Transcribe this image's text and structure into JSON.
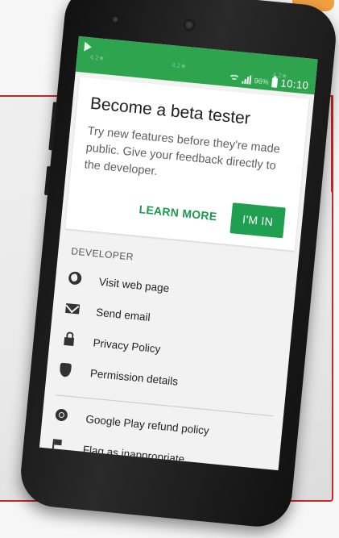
{
  "status_bar": {
    "time": "10:10",
    "battery_percent": "96%",
    "faint_left": "4.2★",
    "faint_mid": "4.2★",
    "faint_right": "4.2★"
  },
  "beta_card": {
    "title": "Become a beta tester",
    "body": "Try new features before they're made public. Give your feedback directly to the developer.",
    "learn_more": "LEARN MORE",
    "im_in": "I'M IN"
  },
  "developer": {
    "section_label": "DEVELOPER",
    "items": [
      {
        "label": "Visit web page",
        "icon": "globe-icon"
      },
      {
        "label": "Send email",
        "icon": "mail-icon"
      },
      {
        "label": "Privacy Policy",
        "icon": "lock-icon"
      },
      {
        "label": "Permission details",
        "icon": "shield-icon"
      }
    ]
  },
  "footer_items": [
    {
      "label": "Google Play refund policy",
      "icon": "refund-icon"
    },
    {
      "label": "Flag as inappropriate",
      "icon": "flag-icon"
    }
  ],
  "colors": {
    "play_green": "#2ea44f",
    "accent_green": "#1fa050",
    "frame_red": "#c62828"
  }
}
